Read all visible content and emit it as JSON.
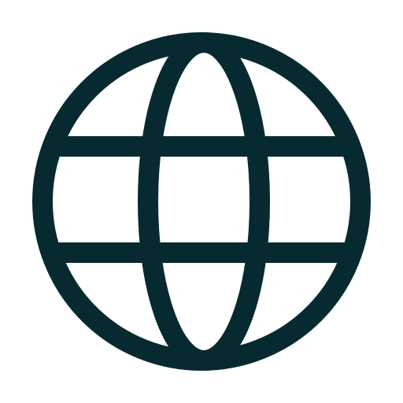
{
  "icon": {
    "name": "globe-icon",
    "color": "#072A30",
    "background": "#FFFFFF"
  }
}
